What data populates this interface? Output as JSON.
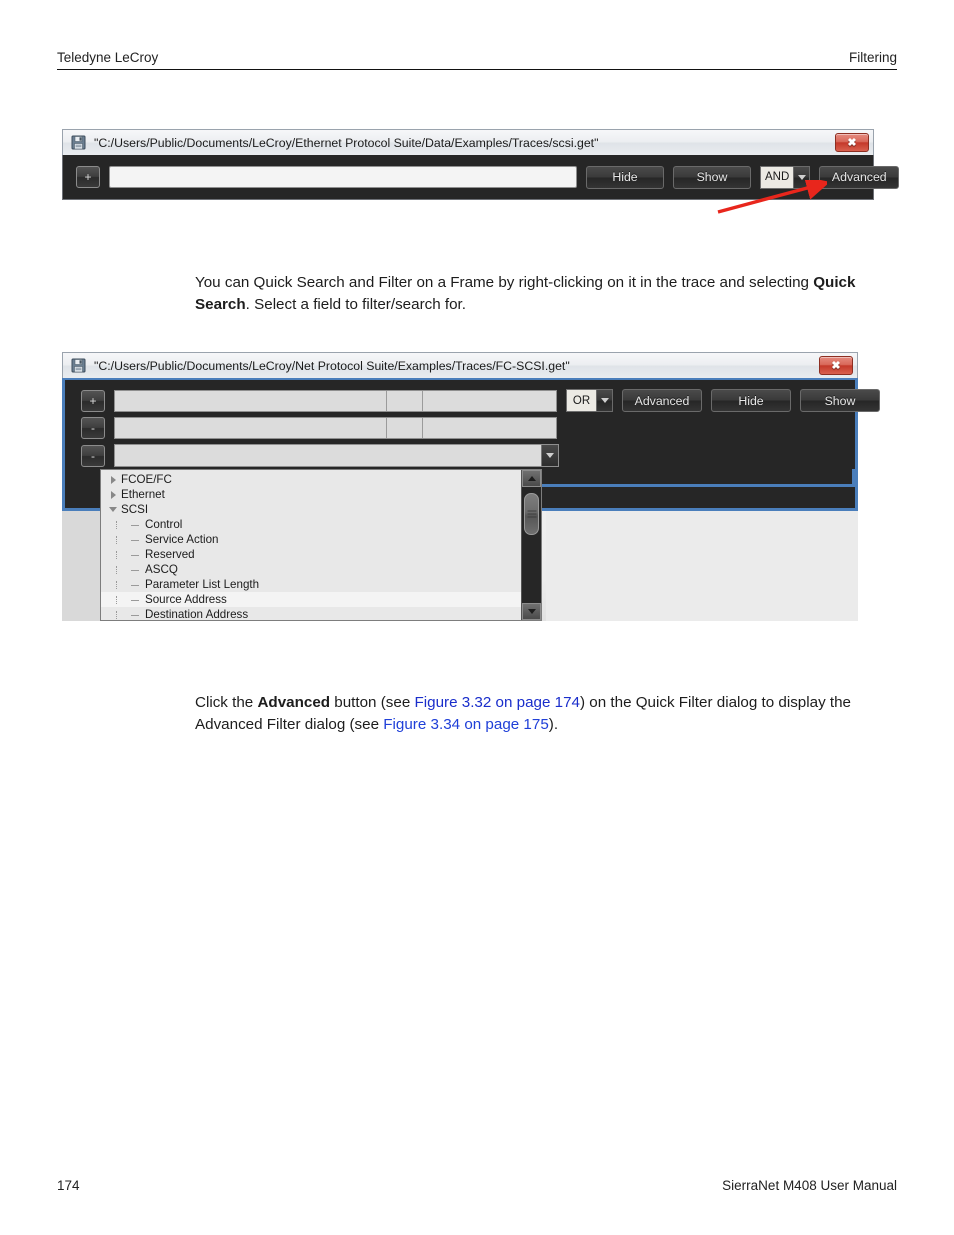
{
  "page": {
    "header_left": "Teledyne LeCroy",
    "header_right": "Filtering",
    "footer_page": "174",
    "footer_right": "SierraNet M408 User Manual"
  },
  "paragraph1": {
    "part1": "You can Quick Search and Filter on a Frame by right-clicking on it in the trace and selecting ",
    "bold": "Quick Search",
    "part2": ". Select a field to filter/search for."
  },
  "paragraph2": {
    "part1": "Click the ",
    "bold": "Advanced",
    "part2": " button (see ",
    "link1": "Figure 3.32 on page 174",
    "part3": ") on the Quick Filter dialog to display the Advanced Filter dialog (see ",
    "link2": "Figure 3.34 on page 175",
    "part4": ")."
  },
  "figure1": {
    "title": "\"C:/Users/Public/Documents/LeCroy/Ethernet Protocol Suite/Data/Examples/Traces/scsi.get\"",
    "close_label": "✖",
    "add_row_label": "+",
    "field_value": "",
    "buttons": {
      "hide": "Hide",
      "show": "Show",
      "advanced": "Advanced"
    },
    "logic_operator": "AND"
  },
  "figure2": {
    "title": "\"C:/Users/Public/Documents/LeCroy/Net Protocol Suite/Examples/Traces/FC-SCSI.get\"",
    "close_label": "✖",
    "row1_button": "+",
    "row2_button": "-",
    "row3_button": "-",
    "logic_operator": "OR",
    "buttons": {
      "advanced": "Advanced",
      "hide": "Hide",
      "show": "Show"
    },
    "dropdown_items": [
      {
        "label": "FCOE/FC",
        "level": 0,
        "expander": "collapsed",
        "selected": false
      },
      {
        "label": "Ethernet",
        "level": 0,
        "expander": "collapsed",
        "selected": false
      },
      {
        "label": "SCSI",
        "level": 0,
        "expander": "expanded",
        "selected": false
      },
      {
        "label": "Control",
        "level": 1,
        "expander": "none",
        "selected": false
      },
      {
        "label": "Service Action",
        "level": 1,
        "expander": "none",
        "selected": false
      },
      {
        "label": "Reserved",
        "level": 1,
        "expander": "none",
        "selected": false
      },
      {
        "label": "ASCQ",
        "level": 1,
        "expander": "none",
        "selected": false
      },
      {
        "label": "Parameter List Length",
        "level": 1,
        "expander": "none",
        "selected": false
      },
      {
        "label": "Source Address",
        "level": 1,
        "expander": "none",
        "selected": true
      },
      {
        "label": "Destination Address",
        "level": 1,
        "expander": "none",
        "selected": false
      }
    ]
  },
  "annotation": {
    "arrow_color": "#e8261c"
  }
}
